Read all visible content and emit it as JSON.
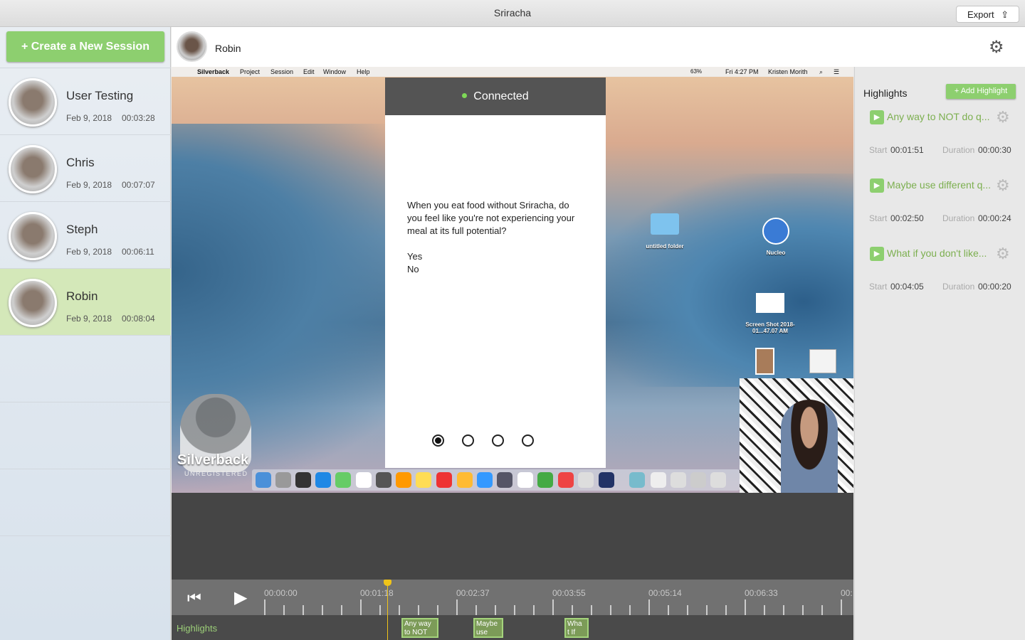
{
  "app": {
    "title": "Sriracha",
    "export_label": "Export",
    "export_icon": "share-icon"
  },
  "sidebar": {
    "create_label": "+ Create a New Session",
    "sessions": [
      {
        "name": "User Testing",
        "date": "Feb 9, 2018",
        "duration": "00:03:28",
        "selected": false
      },
      {
        "name": "Chris",
        "date": "Feb 9, 2018",
        "duration": "00:07:07",
        "selected": false
      },
      {
        "name": "Steph",
        "date": "Feb 9, 2018",
        "duration": "00:06:11",
        "selected": false
      },
      {
        "name": "Robin",
        "date": "Feb 9, 2018",
        "duration": "00:08:04",
        "selected": true
      }
    ]
  },
  "header": {
    "name": "Robin",
    "settings_icon": "gear-icon"
  },
  "recording": {
    "menubar": {
      "app": "Silverback",
      "items": [
        "Project",
        "Session",
        "Edit",
        "Window",
        "Help"
      ],
      "battery": "63%",
      "clock": "Fri 4:27 PM",
      "user": "Kristen Morith"
    },
    "dialog": {
      "status": "Connected",
      "question": "When you eat food without Sriracha, do you feel like you're not experiencing your meal at its full potential?",
      "options": [
        "Yes",
        "No"
      ],
      "page_count": 4,
      "current_page": 1
    },
    "desktop_icons": [
      "untitled folder",
      "Nucleo",
      "Screen Shot 2018-01...47.07 AM"
    ],
    "watermark": {
      "brand": "Silverback",
      "status": "UNREGISTERED"
    }
  },
  "timeline": {
    "labels": [
      "00:00:00",
      "00:01:18",
      "00:02:37",
      "00:03:55",
      "00:05:14",
      "00:06:33",
      "00:"
    ],
    "highlights_label": "Highlights",
    "markers": [
      "Any way to NOT",
      "Maybe use",
      "Wha t If"
    ]
  },
  "highlights": {
    "title": "Highlights",
    "add_label": "+ Add Highlight",
    "start_label": "Start",
    "duration_label": "Duration",
    "items": [
      {
        "title": "Any way to NOT do q...",
        "start": "00:01:51",
        "duration": "00:00:30"
      },
      {
        "title": "Maybe use different q...",
        "start": "00:02:50",
        "duration": "00:00:24"
      },
      {
        "title": "What if you don't like...",
        "start": "00:04:05",
        "duration": "00:00:20"
      }
    ]
  },
  "colors": {
    "accent": "#8dcf6f",
    "selected": "#d4e8b9",
    "playhead": "#f0c419"
  }
}
